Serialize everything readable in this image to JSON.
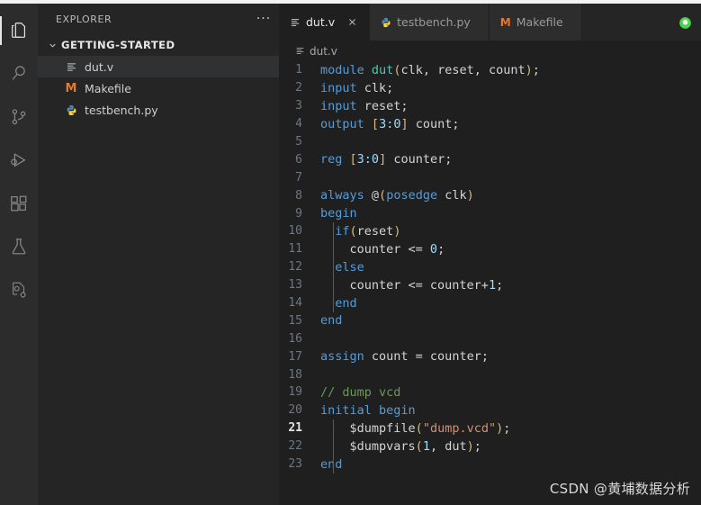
{
  "window": {
    "accent_green": "#4bd14b"
  },
  "activity_bar": {
    "items": [
      {
        "name": "explorer",
        "icon": "files-icon",
        "active": true
      },
      {
        "name": "search",
        "icon": "search-icon",
        "active": false
      },
      {
        "name": "source-control",
        "icon": "source-control-icon",
        "active": false
      },
      {
        "name": "run-and-debug",
        "icon": "run-debug-icon",
        "active": false
      },
      {
        "name": "extensions",
        "icon": "extensions-icon",
        "active": false
      },
      {
        "name": "testing",
        "icon": "beaker-icon",
        "active": false
      },
      {
        "name": "cocotb",
        "icon": "file-gear-icon",
        "active": false
      }
    ]
  },
  "sidebar": {
    "title": "EXPLORER",
    "more_actions": "···",
    "folder": {
      "label": "GETTING-STARTED",
      "expanded": true
    },
    "files": [
      {
        "label": "dut.v",
        "icon": "verilog-file-icon",
        "selected": true
      },
      {
        "label": "Makefile",
        "icon": "makefile-icon",
        "selected": false
      },
      {
        "label": "testbench.py",
        "icon": "python-file-icon",
        "selected": false
      }
    ]
  },
  "tabs": [
    {
      "label": "dut.v",
      "icon": "verilog-file-icon",
      "active": true,
      "close": "×"
    },
    {
      "label": "testbench.py",
      "icon": "python-file-icon",
      "active": false,
      "close": ""
    },
    {
      "label": "Makefile",
      "icon": "makefile-icon",
      "active": false,
      "close": ""
    }
  ],
  "breadcrumb": {
    "icon": "verilog-file-icon",
    "label": "dut.v"
  },
  "editor": {
    "active_line": 21,
    "lines": [
      {
        "n": "1",
        "tokens": [
          {
            "t": "module",
            "c": "kw"
          },
          {
            "t": " ",
            "c": "id"
          },
          {
            "t": "dut",
            "c": "fn"
          },
          {
            "t": "(",
            "c": "pn"
          },
          {
            "t": "clk, reset, count",
            "c": "id"
          },
          {
            "t": ")",
            "c": "pn"
          },
          {
            "t": ";",
            "c": "id"
          }
        ]
      },
      {
        "n": "2",
        "tokens": [
          {
            "t": "input",
            "c": "kw"
          },
          {
            "t": " clk;",
            "c": "id"
          }
        ]
      },
      {
        "n": "3",
        "tokens": [
          {
            "t": "input",
            "c": "kw"
          },
          {
            "t": " reset;",
            "c": "id"
          }
        ]
      },
      {
        "n": "4",
        "tokens": [
          {
            "t": "output",
            "c": "kw"
          },
          {
            "t": " ",
            "c": "id"
          },
          {
            "t": "[",
            "c": "pn"
          },
          {
            "t": "3:0",
            "c": "num"
          },
          {
            "t": "]",
            "c": "pn"
          },
          {
            "t": " count;",
            "c": "id"
          }
        ]
      },
      {
        "n": "5",
        "tokens": []
      },
      {
        "n": "6",
        "tokens": [
          {
            "t": "reg",
            "c": "kw"
          },
          {
            "t": " ",
            "c": "id"
          },
          {
            "t": "[",
            "c": "pn"
          },
          {
            "t": "3:0",
            "c": "num"
          },
          {
            "t": "]",
            "c": "pn"
          },
          {
            "t": " counter;",
            "c": "id"
          }
        ]
      },
      {
        "n": "7",
        "tokens": []
      },
      {
        "n": "8",
        "tokens": [
          {
            "t": "always",
            "c": "kw"
          },
          {
            "t": " @",
            "c": "id"
          },
          {
            "t": "(",
            "c": "pn"
          },
          {
            "t": "posedge",
            "c": "kw"
          },
          {
            "t": " clk",
            "c": "id"
          },
          {
            "t": ")",
            "c": "pn"
          }
        ]
      },
      {
        "n": "9",
        "tokens": [
          {
            "t": "begin",
            "c": "kw"
          }
        ]
      },
      {
        "n": "10",
        "tokens": [
          {
            "t": "  ",
            "c": "id"
          },
          {
            "t": "if",
            "c": "kw"
          },
          {
            "t": "(",
            "c": "pn"
          },
          {
            "t": "reset",
            "c": "id"
          },
          {
            "t": ")",
            "c": "pn"
          }
        ]
      },
      {
        "n": "11",
        "tokens": [
          {
            "t": "    counter <= ",
            "c": "id"
          },
          {
            "t": "0",
            "c": "num"
          },
          {
            "t": ";",
            "c": "id"
          }
        ]
      },
      {
        "n": "12",
        "tokens": [
          {
            "t": "  ",
            "c": "id"
          },
          {
            "t": "else",
            "c": "kw"
          }
        ]
      },
      {
        "n": "13",
        "tokens": [
          {
            "t": "    counter <= counter+",
            "c": "id"
          },
          {
            "t": "1",
            "c": "num"
          },
          {
            "t": ";",
            "c": "id"
          }
        ]
      },
      {
        "n": "14",
        "tokens": [
          {
            "t": "  ",
            "c": "id"
          },
          {
            "t": "end",
            "c": "kw"
          }
        ]
      },
      {
        "n": "15",
        "tokens": [
          {
            "t": "end",
            "c": "kw"
          }
        ]
      },
      {
        "n": "16",
        "tokens": []
      },
      {
        "n": "17",
        "tokens": [
          {
            "t": "assign",
            "c": "kw"
          },
          {
            "t": " count = counter;",
            "c": "id"
          }
        ]
      },
      {
        "n": "18",
        "tokens": []
      },
      {
        "n": "19",
        "tokens": [
          {
            "t": "// dump vcd",
            "c": "cmt"
          }
        ]
      },
      {
        "n": "20",
        "tokens": [
          {
            "t": "initial",
            "c": "kw"
          },
          {
            "t": " ",
            "c": "id"
          },
          {
            "t": "begin",
            "c": "kw"
          }
        ]
      },
      {
        "n": "21",
        "tokens": [
          {
            "t": "    $dumpfile",
            "c": "id"
          },
          {
            "t": "(",
            "c": "pn"
          },
          {
            "t": "\"dump.vcd\"",
            "c": "str"
          },
          {
            "t": ")",
            "c": "pn"
          },
          {
            "t": ";",
            "c": "id"
          }
        ]
      },
      {
        "n": "22",
        "tokens": [
          {
            "t": "    $dumpvars",
            "c": "id"
          },
          {
            "t": "(",
            "c": "pn"
          },
          {
            "t": "1",
            "c": "num"
          },
          {
            "t": ", dut",
            "c": "id"
          },
          {
            "t": ")",
            "c": "pn"
          },
          {
            "t": ";",
            "c": "id"
          }
        ]
      },
      {
        "n": "23",
        "tokens": [
          {
            "t": "end",
            "c": "kw"
          }
        ]
      }
    ]
  },
  "watermark": {
    "text": "CSDN @黄埔数据分析"
  }
}
